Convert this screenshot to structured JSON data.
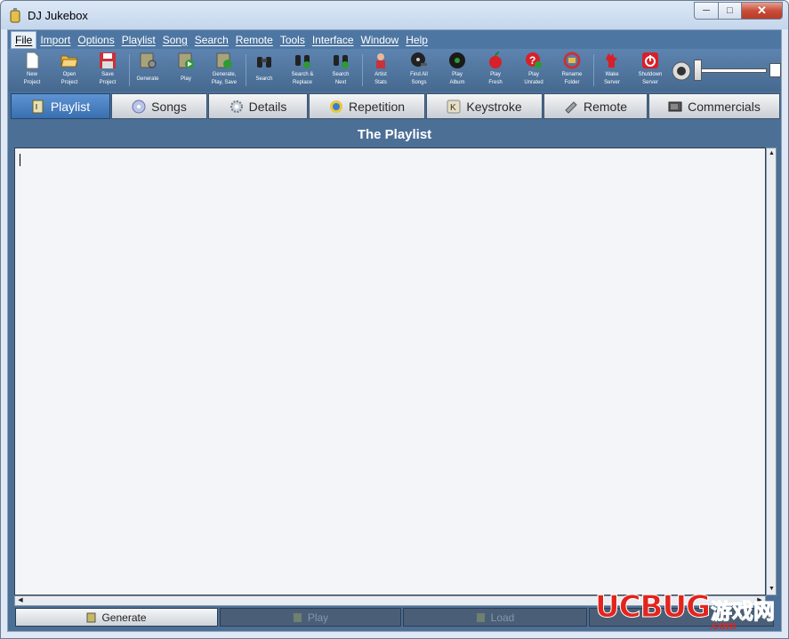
{
  "window": {
    "title": "DJ Jukebox",
    "controls": {
      "minimize": "─",
      "maximize": "□",
      "close": "✕"
    }
  },
  "menu": [
    "File",
    "Import",
    "Options",
    "Playlist",
    "Song",
    "Search",
    "Remote",
    "Tools",
    "Interface",
    "Window",
    "Help"
  ],
  "toolbar": {
    "buttons": [
      {
        "label1": "New",
        "label2": "Project",
        "icon": "new-page-icon"
      },
      {
        "label1": "Open",
        "label2": "Project",
        "icon": "open-folder-icon"
      },
      {
        "label1": "Save",
        "label2": "Project",
        "icon": "floppy-icon"
      },
      {
        "label1": "Generate",
        "label2": "",
        "icon": "generate-icon"
      },
      {
        "label1": "Play",
        "label2": "",
        "icon": "play-doc-icon"
      },
      {
        "label1": "Generate,",
        "label2": "Play, Save",
        "icon": "generate-play-icon"
      },
      {
        "label1": "Search",
        "label2": "",
        "icon": "binoculars-icon"
      },
      {
        "label1": "Search &",
        "label2": "Replace",
        "icon": "binoculars-replace-icon"
      },
      {
        "label1": "Search",
        "label2": "Next",
        "icon": "binoculars-next-icon"
      },
      {
        "label1": "Artist",
        "label2": "Stats",
        "icon": "artist-icon"
      },
      {
        "label1": "Find All",
        "label2": "Songs",
        "icon": "cd-search-icon"
      },
      {
        "label1": "Play",
        "label2": "Album",
        "icon": "album-icon"
      },
      {
        "label1": "Play",
        "label2": "Fresh",
        "icon": "apple-icon"
      },
      {
        "label1": "Play",
        "label2": "Unrated",
        "icon": "unrated-icon"
      },
      {
        "label1": "Rename",
        "label2": "Folder",
        "icon": "rename-icon"
      },
      {
        "label1": "Wake",
        "label2": "Server",
        "icon": "rooster-icon"
      },
      {
        "label1": "Shutdown",
        "label2": "Server",
        "icon": "power-icon"
      }
    ],
    "volume_level": 0.0
  },
  "tabs": [
    {
      "label": "Playlist",
      "selected": true,
      "icon": "playlist-icon"
    },
    {
      "label": "Songs",
      "selected": false,
      "icon": "cd-icon"
    },
    {
      "label": "Details",
      "selected": false,
      "icon": "gear-icon"
    },
    {
      "label": "Repetition",
      "selected": false,
      "icon": "repeat-icon"
    },
    {
      "label": "Keystroke",
      "selected": false,
      "icon": "key-icon"
    },
    {
      "label": "Remote",
      "selected": false,
      "icon": "remote-icon"
    },
    {
      "label": "Commercials",
      "selected": false,
      "icon": "tv-icon"
    }
  ],
  "section_title": "The Playlist",
  "bottom_buttons": [
    {
      "label": "Generate",
      "enabled": true
    },
    {
      "label": "Play",
      "enabled": false
    },
    {
      "label": "Load",
      "enabled": false
    }
  ],
  "watermark": {
    "main": "UCBUG",
    "cjk": "游戏网",
    "com": ".com"
  },
  "colors": {
    "accent": "#4e76a2",
    "tab_selected": "#3a6fb0",
    "close": "#c84e3a"
  }
}
